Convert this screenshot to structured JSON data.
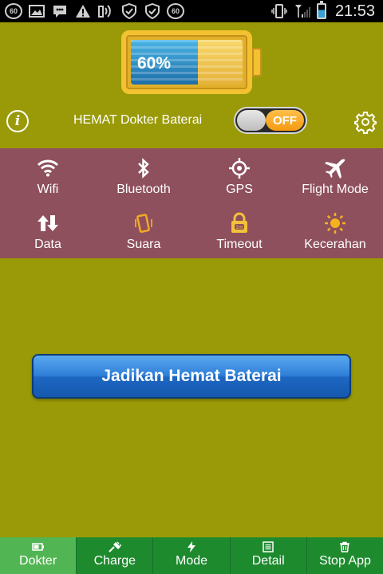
{
  "status_bar": {
    "left_badge": "60",
    "right_badge": "60",
    "time": "21:53"
  },
  "battery": {
    "level_percent": 60,
    "label": "60%"
  },
  "header": {
    "title": "HEMAT Dokter Baterai",
    "toggle_label": "OFF"
  },
  "quick_settings": [
    {
      "label": "Wifi",
      "icon": "wifi-icon"
    },
    {
      "label": "Bluetooth",
      "icon": "bluetooth-icon"
    },
    {
      "label": "GPS",
      "icon": "gps-icon"
    },
    {
      "label": "Flight Mode",
      "icon": "airplane-icon"
    },
    {
      "label": "Data",
      "icon": "data-arrows-icon"
    },
    {
      "label": "Suara",
      "icon": "phone-vibrate-icon"
    },
    {
      "label": "Timeout",
      "icon": "lock-timer-icon"
    },
    {
      "label": "Kecerahan",
      "icon": "sun-icon"
    }
  ],
  "main_button": {
    "label": "Jadikan Hemat Baterai"
  },
  "tabs": [
    {
      "label": "Dokter",
      "icon": "battery-icon"
    },
    {
      "label": "Charge",
      "icon": "plug-icon"
    },
    {
      "label": "Mode",
      "icon": "lightning-icon"
    },
    {
      "label": "Detail",
      "icon": "list-icon"
    },
    {
      "label": "Stop App",
      "icon": "trash-icon"
    }
  ],
  "colors": {
    "background": "#9a9a08",
    "panel": "#8e505c",
    "tab_bar": "#1e8a2e",
    "tab_active": "#52b553",
    "button": "#2f7fd8",
    "battery_frame": "#f2c230",
    "battery_fill": "#3aa0d8",
    "toggle_off": "#f59a12"
  }
}
